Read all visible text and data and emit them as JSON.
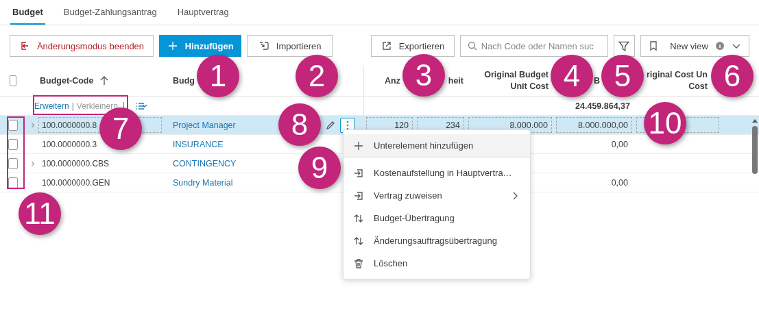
{
  "tabs": [
    {
      "label": "Budget",
      "selected": true
    },
    {
      "label": "Budget-Zahlungsantrag",
      "selected": false
    },
    {
      "label": "Hauptvertrag",
      "selected": false
    }
  ],
  "toolbar": {
    "exit_button": "Änderungsmodus beenden",
    "add_button": "Hinzufügen",
    "import_button": "Importieren",
    "export_button": "Exportieren",
    "search": {
      "placeholder": "Nach Code oder Namen suc"
    },
    "view_select": "New view"
  },
  "table": {
    "select_all": {
      "checked": false
    },
    "columns": [
      {
        "parts": [
          "Budget-Code"
        ],
        "sorted_ascending": true
      },
      {
        "parts": [
          "Budg"
        ]
      },
      {
        "parts": [
          "Anz"
        ]
      },
      {
        "parts": [
          "heit"
        ]
      },
      {
        "parts": [
          "Original Budget",
          "Unit Cost"
        ]
      },
      {
        "parts": [
          "B"
        ]
      },
      {
        "parts": [
          "riginal Cost Un",
          "Cost"
        ]
      }
    ],
    "tree_controls": {
      "expand": "Erweitern",
      "separator": "|",
      "collapse": "Verkleinern",
      "collapse_disabled": true
    },
    "total": "24.459.864,37",
    "rows": [
      {
        "expandable": true,
        "checked": false,
        "selected": true,
        "cells": [
          "100.0000000.8",
          "Project Manager",
          "120",
          "234",
          "8.000.000",
          "8.000.000,00",
          ""
        ]
      },
      {
        "expandable": false,
        "checked": false,
        "selected": false,
        "cells": [
          "100.0000000.3",
          "INSURANCE",
          "",
          "",
          "",
          "0,00",
          ""
        ]
      },
      {
        "expandable": true,
        "checked": false,
        "selected": false,
        "cells": [
          "100.0000000.CBS",
          "CONTINGENCY",
          "",
          "",
          "",
          "",
          ""
        ]
      },
      {
        "expandable": false,
        "checked": false,
        "selected": false,
        "cells": [
          "100.0000000.GEN",
          "Sundry Material",
          "",
          "",
          "",
          "0,00",
          ""
        ]
      }
    ]
  },
  "context_menu": [
    {
      "kind": "add",
      "label": "Unterelement hinzufügen",
      "highlighted": true,
      "divider_after": true
    },
    {
      "kind": "assign",
      "label": "Kostenaufstellung in Hauptvertra…",
      "highlighted": false
    },
    {
      "kind": "assign",
      "label": "Vertrag zuweisen",
      "highlighted": false,
      "submenu": true
    },
    {
      "kind": "transfer",
      "label": "Budget-Übertragung",
      "highlighted": false
    },
    {
      "kind": "transfer",
      "label": "Änderungsauftragsübertragung",
      "highlighted": false
    },
    {
      "kind": "delete",
      "label": "Löschen",
      "highlighted": false
    }
  ],
  "callouts": [
    {
      "label": "1"
    },
    {
      "label": "2"
    },
    {
      "label": "3"
    },
    {
      "label": "4"
    },
    {
      "label": "5"
    },
    {
      "label": "6"
    },
    {
      "label": "7"
    },
    {
      "label": "8"
    },
    {
      "label": "9"
    },
    {
      "label": "10"
    },
    {
      "label": "11"
    }
  ]
}
